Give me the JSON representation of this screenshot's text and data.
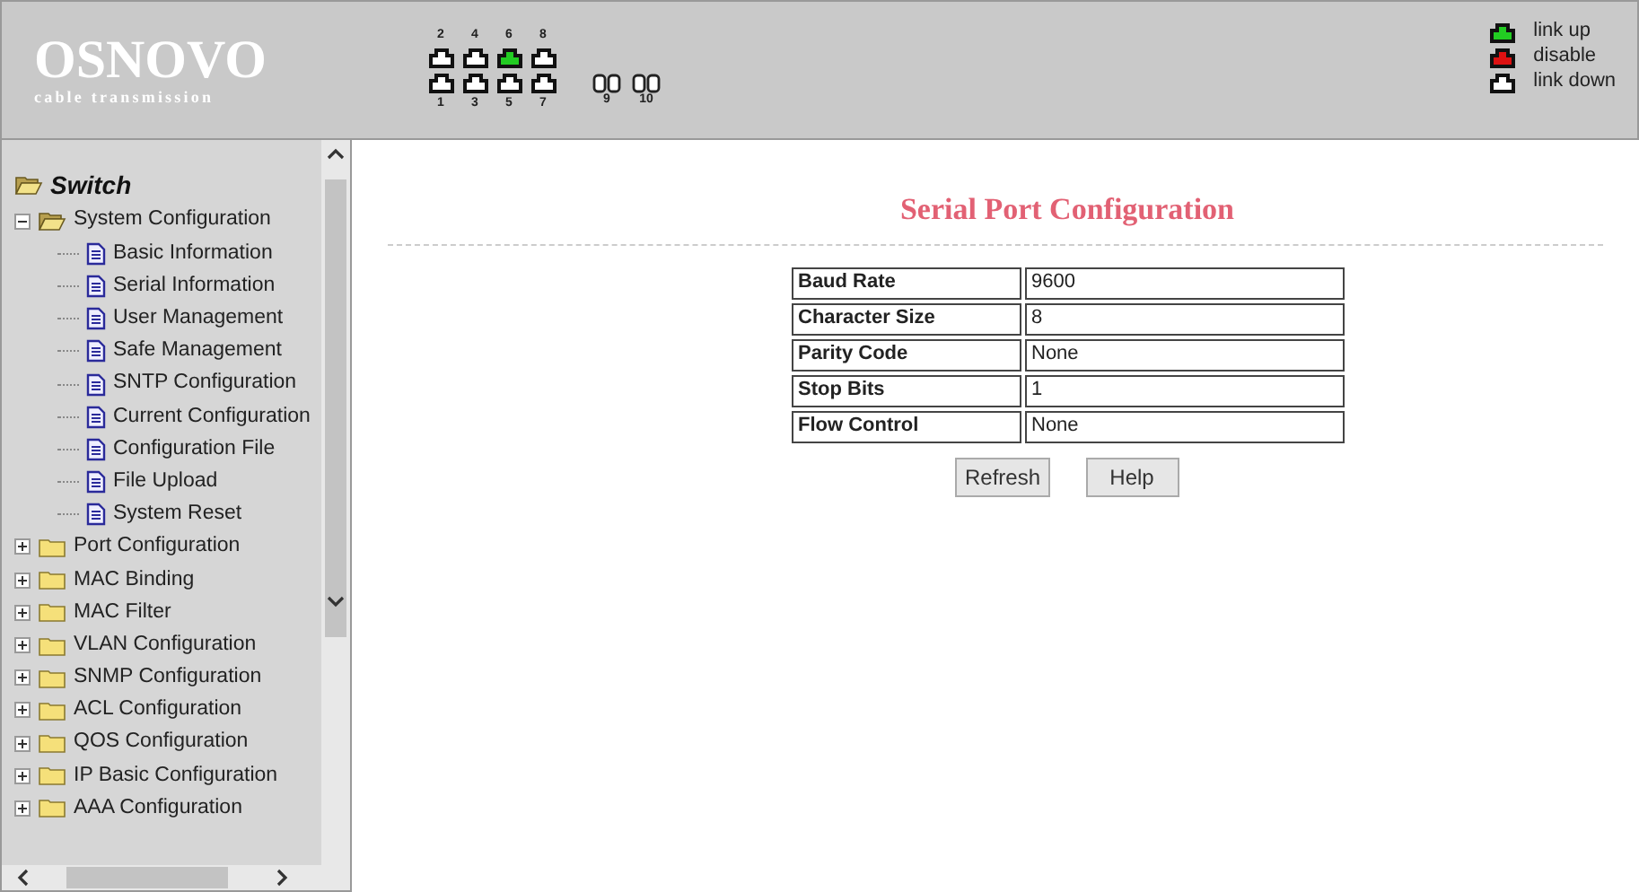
{
  "header": {
    "logo": "OSNOVO",
    "tagline": "cable transmission",
    "ports_top": [
      {
        "label": "2",
        "color": "#ffffff"
      },
      {
        "label": "4",
        "color": "#ffffff"
      },
      {
        "label": "6",
        "color": "#22cc22"
      },
      {
        "label": "8",
        "color": "#ffffff"
      }
    ],
    "ports_bottom": [
      {
        "label": "1",
        "color": "#ffffff"
      },
      {
        "label": "3",
        "color": "#ffffff"
      },
      {
        "label": "5",
        "color": "#ffffff"
      },
      {
        "label": "7",
        "color": "#ffffff"
      }
    ],
    "sfp_ports": [
      {
        "label": "9",
        "color": "#ffffff"
      },
      {
        "label": "10",
        "color": "#ffffff"
      }
    ],
    "legend": [
      {
        "label": "link up",
        "color": "#22cc22"
      },
      {
        "label": "disable",
        "color": "#dd1111"
      },
      {
        "label": "link down",
        "color": "#ffffff"
      }
    ]
  },
  "sidebar": {
    "tree": {
      "label": "Switch",
      "expanded": true,
      "children": [
        {
          "label": "System Configuration",
          "kind": "folder",
          "expanded": true,
          "children": [
            {
              "label": "Basic Information",
              "kind": "page"
            },
            {
              "label": "Serial Information",
              "kind": "page"
            },
            {
              "label": "User Management",
              "kind": "page"
            },
            {
              "label": "Safe Management",
              "kind": "page"
            },
            {
              "label": "SNTP Configuration",
              "kind": "page"
            },
            {
              "label": "Current Configuration",
              "kind": "page"
            },
            {
              "label": "Configuration File",
              "kind": "page"
            },
            {
              "label": "File Upload",
              "kind": "page"
            },
            {
              "label": "System Reset",
              "kind": "page"
            }
          ]
        },
        {
          "label": "Port Configuration",
          "kind": "folder",
          "expanded": false
        },
        {
          "label": "MAC Binding",
          "kind": "folder",
          "expanded": false
        },
        {
          "label": "MAC Filter",
          "kind": "folder",
          "expanded": false
        },
        {
          "label": "VLAN Configuration",
          "kind": "folder",
          "expanded": false
        },
        {
          "label": "SNMP Configuration",
          "kind": "folder",
          "expanded": false
        },
        {
          "label": "ACL Configuration",
          "kind": "folder",
          "expanded": false
        },
        {
          "label": "QOS Configuration",
          "kind": "folder",
          "expanded": false
        },
        {
          "label": "IP Basic Configuration",
          "kind": "folder",
          "expanded": false
        },
        {
          "label": "AAA Configuration",
          "kind": "folder",
          "expanded": false
        }
      ]
    }
  },
  "main": {
    "title": "Serial Port Configuration",
    "rows": [
      {
        "label": "Baud Rate",
        "value": "9600"
      },
      {
        "label": "Character Size",
        "value": "8"
      },
      {
        "label": "Parity Code",
        "value": "None"
      },
      {
        "label": "Stop Bits",
        "value": "1"
      },
      {
        "label": "Flow Control",
        "value": "None"
      }
    ],
    "buttons": [
      "Refresh",
      "Help"
    ]
  }
}
